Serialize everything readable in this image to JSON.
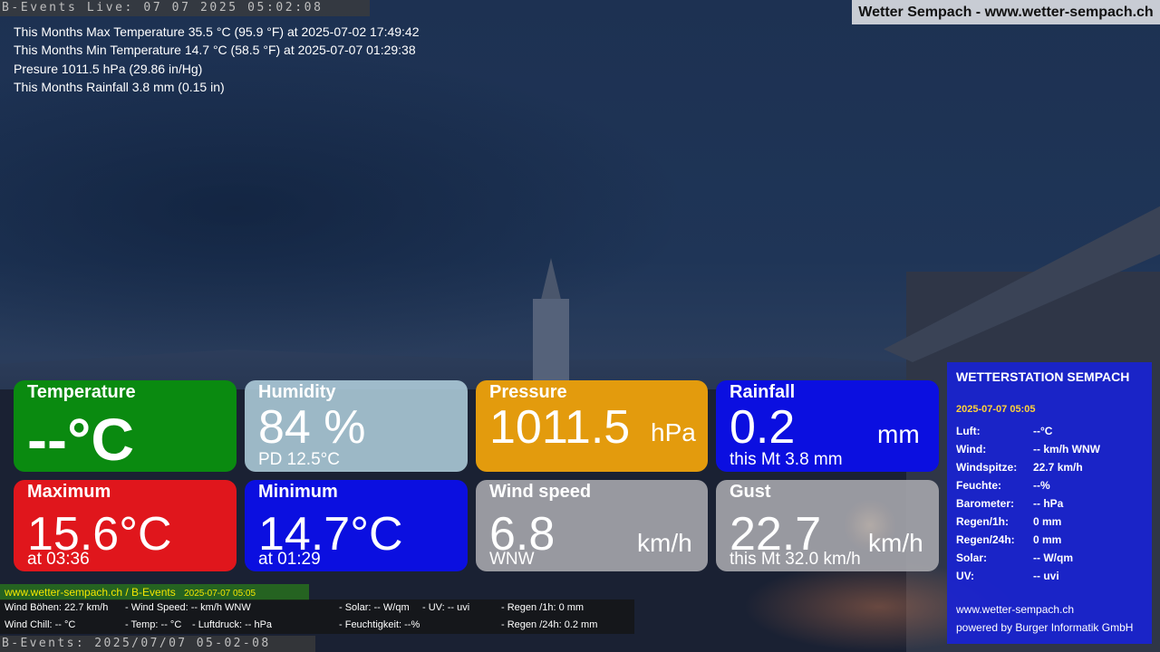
{
  "header": {
    "live_stamp": "B-Events Live: 07 07 2025 05:02:08",
    "site_title": "Wetter Sempach - www.wetter-sempach.ch"
  },
  "stats": [
    "This Months Max Temperature 35.5 °C (95.9 °F) at 2025-07-02 17:49:42",
    "This Months Min Temperature 14.7 °C (58.5 °F) at 2025-07-07 01:29:38",
    "Presure 1011.5 hPa (29.86 in/Hg)",
    "This Months Rainfall 3.8 mm (0.15 in)"
  ],
  "tiles": {
    "temperature": {
      "label": "Temperature",
      "value": "--°C"
    },
    "humidity": {
      "label": "Humidity",
      "value": "84 %",
      "sub": "PD 12.5°C"
    },
    "pressure": {
      "label": "Pressure",
      "value": "1011.5",
      "unit": "hPa"
    },
    "rainfall": {
      "label": "Rainfall",
      "value": "0.2",
      "unit": "mm",
      "sub": "this Mt 3.8 mm"
    },
    "maximum": {
      "label": "Maximum",
      "value": "15.6°C",
      "sub": "at 03:36"
    },
    "minimum": {
      "label": "Minimum",
      "value": "14.7°C",
      "sub": "at 01:29"
    },
    "wind_speed": {
      "label": "Wind speed",
      "value": "6.8",
      "unit": "km/h",
      "sub": "WNW"
    },
    "gust": {
      "label": "Gust",
      "value": "22.7",
      "unit": "km/h",
      "sub": "this Mt 32.0 km/h"
    }
  },
  "station": {
    "title": "WETTERSTATION SEMPACH",
    "date": "2025-07-07 05:05",
    "rows": [
      {
        "k": "Luft:",
        "v": "--°C"
      },
      {
        "k": "Wind:",
        "v": "-- km/h  WNW"
      },
      {
        "k": "Windspitze:",
        "v": "22.7 km/h"
      },
      {
        "k": "Feuchte:",
        "v": "--%"
      },
      {
        "k": "Barometer:",
        "v": "-- hPa"
      },
      {
        "k": "Regen/1h:",
        "v": "0 mm"
      },
      {
        "k": "Regen/24h:",
        "v": "0 mm"
      },
      {
        "k": "Solar:",
        "v": "-- W/qm"
      },
      {
        "k": "UV:",
        "v": "-- uvi"
      }
    ],
    "footer_url": "www.wetter-sempach.ch",
    "footer_powered": "powered by Burger Informatik GmbH"
  },
  "footer": {
    "site_link": "www.wetter-sempach.ch / B-Events",
    "site_date": "2025-07-07 05:05",
    "data": {
      "wind_boehen": "Wind Böhen: 22.7 km/h",
      "wind_speed": "- Wind Speed: -- km/h WNW",
      "solar": "- Solar: -- W/qm",
      "uv": "- UV: -- uvi",
      "regen_1h": "- Regen /1h:   0 mm",
      "wind_chill": "Wind Chill: -- °C",
      "temp": "- Temp: -- °C",
      "luftdruck": "- Luftdruck: -- hPa",
      "feuchtigkeit": "- Feuchtigkeit: --%",
      "regen_24h": "- Regen /24h: 0.2 mm"
    },
    "bottom_stamp": "B-Events: 2025/07/07 05-02-08"
  },
  "colors": {
    "temperature": "#0a8a10",
    "humidity": "#b4d2e1",
    "pressure": "#e39b0d",
    "rainfall": "#0b0fe0",
    "maximum": "#e0161c",
    "minimum": "#0b0fe0",
    "wind_speed": "#aaaaaf",
    "gust": "#aaaaaf",
    "station_panel": "#1923d2"
  }
}
